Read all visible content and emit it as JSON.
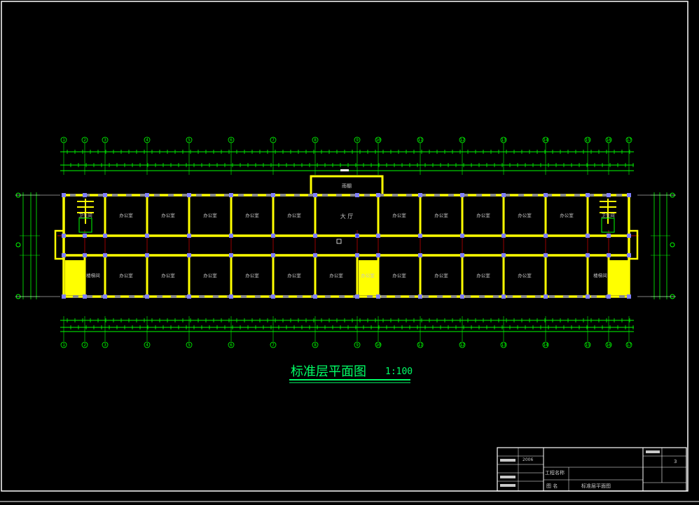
{
  "drawing": {
    "title": "标准层平面图",
    "scale": "1:100",
    "canopy_label": "雨棚",
    "hall_label": "大 厅"
  },
  "rooms": {
    "top": [
      "卫生间",
      "办公室",
      "办公室",
      "办公室",
      "办公室",
      "办公室",
      "大 厅",
      "办公室",
      "办公室",
      "办公室",
      "办公室",
      "办公室",
      "卫生间"
    ],
    "bottom": [
      "楼梯间",
      "办公室",
      "办公室",
      "办公室",
      "办公室",
      "办公室",
      "办公室",
      "办公室",
      "办公室",
      "办公室",
      "办公室",
      "办公室",
      "楼梯间"
    ]
  },
  "axes": {
    "top_labels": [
      "1",
      "2",
      "3",
      "4",
      "5",
      "6",
      "7",
      "8",
      "9",
      "10",
      "11",
      "12",
      "13",
      "14",
      "15",
      "16",
      "17",
      "18",
      "19"
    ],
    "bottom_labels": [
      "1",
      "2",
      "3",
      "4",
      "5",
      "6",
      "7",
      "8",
      "9",
      "10",
      "11",
      "12",
      "13",
      "14",
      "15",
      "16",
      "17",
      "18",
      "19"
    ]
  },
  "title_block": {
    "project_label": "工程名称",
    "drawing_name_label": "图 名",
    "drawing_name": "标准层平面图",
    "sheet_number": "3",
    "year": "2006"
  },
  "colors": {
    "wall": "#ffff00",
    "dimension": "#00ff00",
    "frame": "#ffffff",
    "axis_red": "#ff0000",
    "text": "#c8c8c8"
  }
}
